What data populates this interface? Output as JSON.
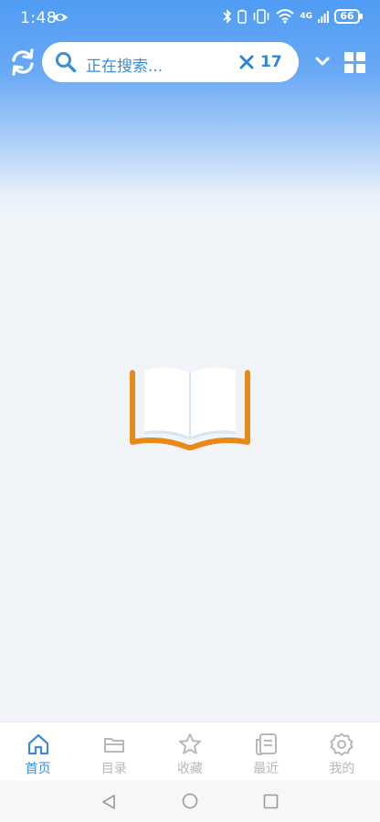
{
  "status_bar": {
    "time": "1:48",
    "network": "4G",
    "battery": "66"
  },
  "header": {
    "search": {
      "text": "正在搜索...",
      "result_count": "17"
    }
  },
  "tab_bar": {
    "items": [
      {
        "label": "首页",
        "icon": "home-icon",
        "active": true
      },
      {
        "label": "目录",
        "icon": "folder-icon",
        "active": false
      },
      {
        "label": "收藏",
        "icon": "star-icon",
        "active": false
      },
      {
        "label": "最近",
        "icon": "recent-icon",
        "active": false
      },
      {
        "label": "我的",
        "icon": "gear-icon",
        "active": false
      }
    ]
  },
  "colors": {
    "accent": "#3f8bd9",
    "header_blue": "#4f9cf4",
    "book_orange": "#e8891c",
    "inactive_tab": "#b8b8b8"
  }
}
